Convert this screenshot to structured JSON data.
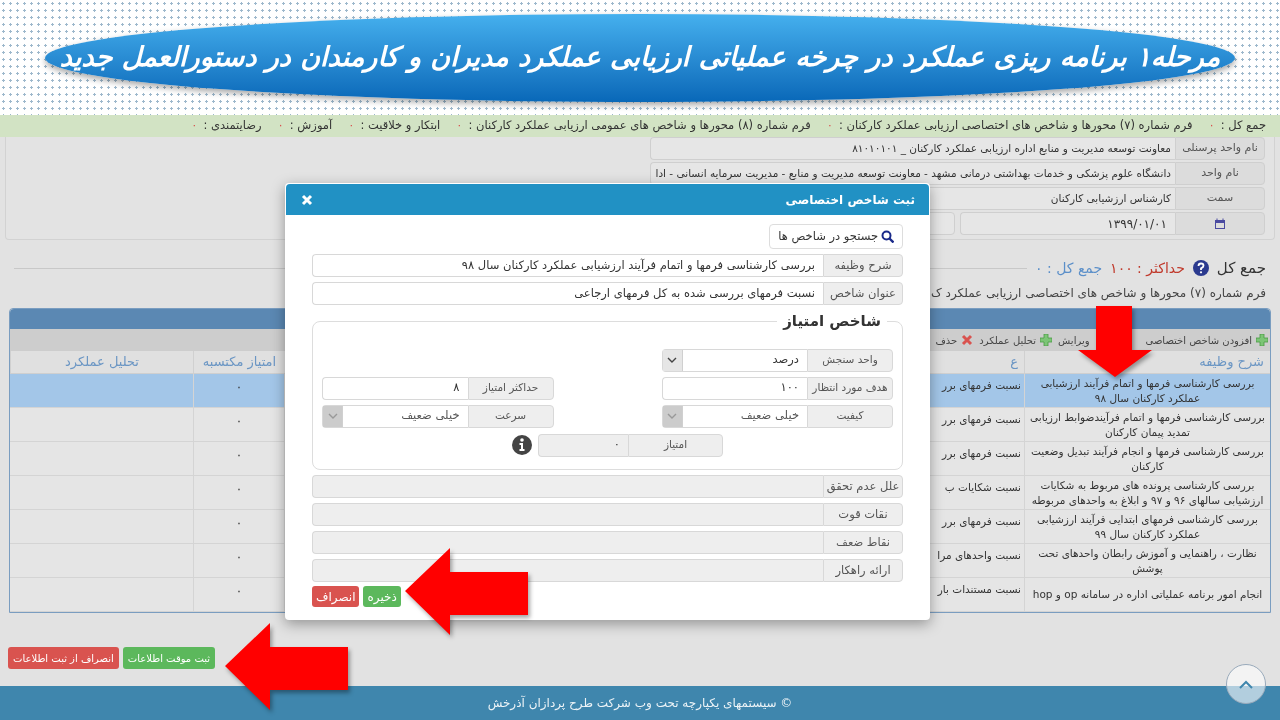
{
  "banner": {
    "title": "مرحله۱ برنامه ریزی عملکرد در چرخه عملیاتی ارزیابی عملکرد مدیران و کارمندان در دستورالعمل جدید"
  },
  "summary_bar": [
    {
      "label": "جمع کل :",
      "value": "۰"
    },
    {
      "label": "فرم شماره (۷) محورها و شاخص های اختصاصی ارزیابی عملکرد کارکنان :",
      "value": "۰"
    },
    {
      "label": "فرم شماره (۸) محورها و شاخص های عمومی ارزیابی عملکرد کارکنان :",
      "value": "۰"
    },
    {
      "label": "ابتکار و خلاقیت :",
      "value": "۰"
    },
    {
      "label": "آموزش :",
      "value": "۰"
    },
    {
      "label": "رضایتمندی :",
      "value": "۰"
    }
  ],
  "profile": [
    {
      "kind": "text",
      "label": "نام واحد پرسنلی",
      "value": "معاونت توسعه مدیریت و منابع اداره ارزیابی عملکرد کارکنان _ ۸۱۰۱۰۱۰۱"
    },
    {
      "kind": "text",
      "label": "نام واحد",
      "value": "دانشگاه علوم پزشکی و خدمات بهداشتی درمانی مشهد - معاونت توسعه مدیریت و منابع - مدیریت سرمایه انسانی - ادا"
    },
    {
      "kind": "text",
      "label": "سمت",
      "value": "کارشناس ارزشیابی کارکنان"
    },
    {
      "kind": "date",
      "value": "۱۳۹۹/۰۱/۰۱"
    }
  ],
  "totals": {
    "label": "جمع کل",
    "max": "حداکثر : ۱۰۰",
    "sum": "جمع کل : ۰"
  },
  "section_title": "فرم شماره (۷) محورها و شاخص های اختصاصی ارزیابی عملکرد ک",
  "table": {
    "toolbar": [
      {
        "label": "افزودن شاخص اختصاصی",
        "kind": "add"
      },
      {
        "label": "ویرایش",
        "kind": "edit"
      },
      {
        "label": "تحلیل عملکرد",
        "kind": "add"
      },
      {
        "label": "حذف",
        "kind": "delete"
      }
    ],
    "columns": [
      "شرح وظیفه",
      "ع",
      "امتیاز مکتسبه",
      "تحلیل عملکرد"
    ],
    "rows": [
      {
        "task": "بررسی کارشناسی فرمها و اتمام فرآیند ارزشیابی عملکرد کارکنان سال ۹۸",
        "indicator": "نسبت فرمهای برر",
        "score": "۰",
        "selected": true
      },
      {
        "task": "بررسی کارشناسی فرمها و اتمام فرآیندضوابط ارزیابی تمدید پیمان کارکنان",
        "indicator": "نسبت فرمهای برر",
        "score": "۰",
        "selected": false
      },
      {
        "task": "بررسی کارشناسی فرمها و انجام فرآیند تبدیل وضعیت کارکنان",
        "indicator": "نسبت فرمهای برر",
        "score": "۰",
        "selected": false
      },
      {
        "task": "بررسی کارشناسی پرونده های مربوط به شکایات ارزشیابی سالهای ۹۶ و ۹۷ و ابلاغ به واحدهای مربوطه",
        "indicator": "نسبت شکایات ب",
        "score": "۰",
        "selected": false
      },
      {
        "task": "بررسی کارشناسی فرمهای ابتدایی فرآیند ارزشیابی عملکرد کارکنان سال ۹۹",
        "indicator": "نسبت فرمهای برر",
        "score": "۰",
        "selected": false
      },
      {
        "task": "نظارت ، راهنمایی و آموزش رابطان واحدهای تحت پوشش",
        "indicator": "نسبت واحدهای مرا",
        "score": "۰",
        "selected": false
      },
      {
        "task": "انجام امور برنامه عملیاتی اداره در سامانه op و hop",
        "indicator": "نسبت مستندات بار",
        "score": "۰",
        "selected": false
      }
    ]
  },
  "actions": [
    {
      "label": "ثبت موقت اطلاعات",
      "kind": "success"
    },
    {
      "label": "انصراف از ثبت اطلاعات",
      "kind": "danger"
    }
  ],
  "footer": {
    "text": "© سیستمهای یکپارچه تحت وب شرکت طرح پردازان آذرخش"
  },
  "dialog": {
    "title": "ثبت شاخص اختصاصی",
    "search_button": "جستجو در شاخص ها",
    "fields": [
      {
        "label": "شرح وظیفه",
        "value": "بررسی کارشناسی فرمها و اتمام فرآیند ارزشیابی عملکرد کارکنان سال ۹۸"
      },
      {
        "label": "عنوان شاخص",
        "value": "نسبت فرمهای بررسی شده به کل فرمهای ارجاعی"
      }
    ],
    "score_group": {
      "legend": "شاخص امتیاز",
      "fields": [
        {
          "kind": "select",
          "label": "واحد سنجش",
          "value": "درصد",
          "disabled": false
        },
        {
          "kind": "text",
          "label": "هدف مورد انتظار",
          "value": "۱۰۰"
        },
        {
          "kind": "text",
          "label": "حداکثر امتیاز",
          "value": "۸"
        },
        {
          "kind": "select",
          "label": "کیفیت",
          "value": "خیلی ضعیف",
          "disabled": true
        },
        {
          "kind": "select",
          "label": "سرعت",
          "value": "خیلی ضعیف",
          "disabled": true
        },
        {
          "kind": "readonly",
          "label": "امتیاز",
          "value": "۰"
        }
      ]
    },
    "notes": [
      {
        "label": "علل عدم تحقق",
        "disabled": true
      },
      {
        "label": "نقات قوت",
        "disabled": true
      },
      {
        "label": "نقاط ضعف",
        "disabled": true
      },
      {
        "label": "ارائه راهکار",
        "disabled": true
      }
    ],
    "buttons": [
      {
        "label": "ذخیره",
        "kind": "success"
      },
      {
        "label": "انصراف",
        "kind": "danger"
      }
    ]
  },
  "annotations": [
    {
      "kind": "down_arrow"
    },
    {
      "kind": "left_arrow"
    },
    {
      "kind": "left_arrow"
    }
  ]
}
